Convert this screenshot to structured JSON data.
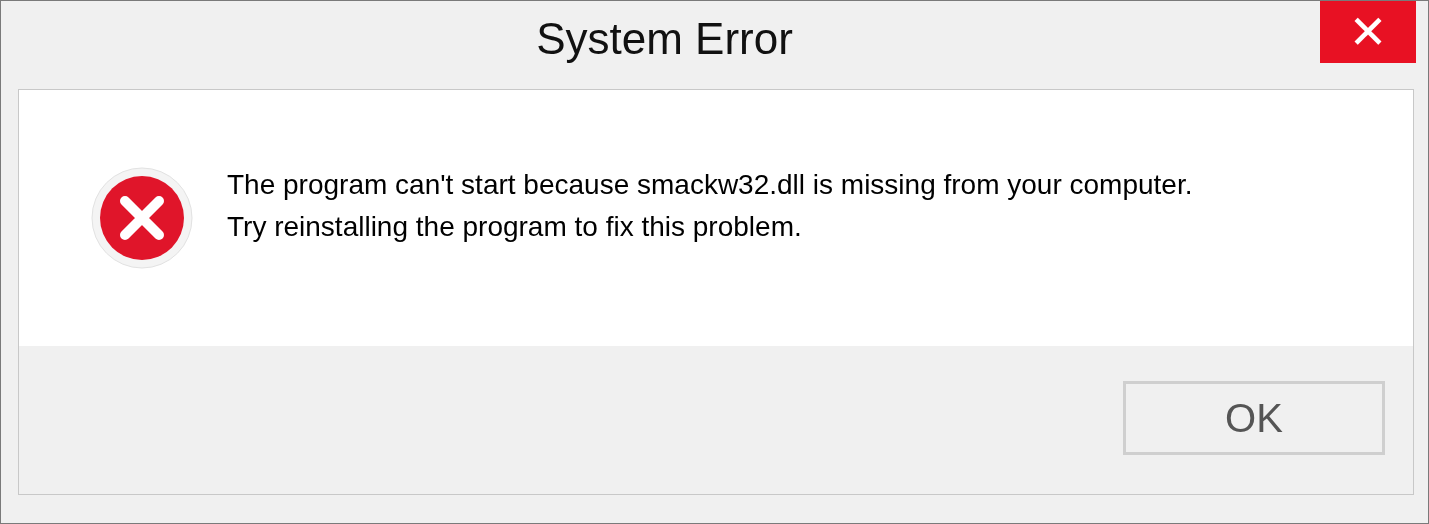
{
  "window": {
    "title": "System Error",
    "close_symbol": "✕"
  },
  "message": {
    "kind": "error",
    "lines": [
      "The program can't start because smackw32.dll is missing from your computer.",
      "Try reinstalling the program to fix this problem."
    ]
  },
  "buttons": [
    {
      "label": "OK"
    }
  ]
}
